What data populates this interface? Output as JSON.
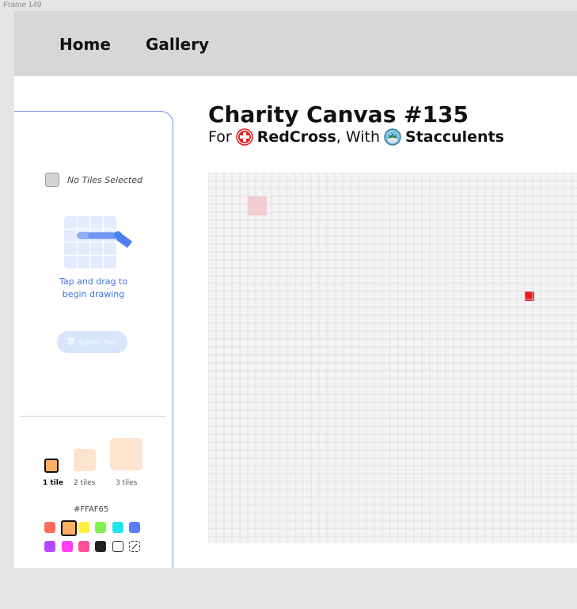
{
  "frame_label": "Frame 149",
  "nav": {
    "home": "Home",
    "gallery": "Gallery"
  },
  "sidebar": {
    "selection_text": "No Tiles Selected",
    "hint_line1": "Tap and drag to",
    "hint_line2": "begin drawing",
    "submit_label": "Submit Tiles",
    "sizes": [
      {
        "label": "1 tile",
        "active": true
      },
      {
        "label": "2 tiles",
        "active": false
      },
      {
        "label": "3 tiles",
        "active": false
      }
    ],
    "selected_hex": "#FFAF65",
    "palette": [
      {
        "name": "coral",
        "color": "#ff6b5b"
      },
      {
        "name": "orange",
        "color": "#ffaf65",
        "selected": true
      },
      {
        "name": "yellow",
        "color": "#ffef40"
      },
      {
        "name": "green",
        "color": "#7ff24d"
      },
      {
        "name": "cyan",
        "color": "#1ee6ea"
      },
      {
        "name": "blue",
        "color": "#5c7dff"
      },
      {
        "name": "purple",
        "color": "#b24bff"
      },
      {
        "name": "magenta",
        "color": "#ff3df2"
      },
      {
        "name": "pink",
        "color": "#ff4f9a"
      },
      {
        "name": "black",
        "color": "#222222"
      },
      {
        "name": "white",
        "color": "#ffffff"
      },
      {
        "name": "eraser",
        "color": "#ffffff"
      }
    ]
  },
  "main": {
    "title": "Charity Canvas #135",
    "for_word": "For",
    "charity": "RedCross",
    "with_word": ", With",
    "artist": "Stacculents"
  },
  "canvas": {
    "grid_color": "#dddddd",
    "background": "#f3f3f3",
    "tiles": [
      {
        "col": 5,
        "row": 3,
        "size": 2,
        "color": "#f6c9cc"
      },
      {
        "col": 40,
        "row": 15,
        "size": 1,
        "color": "#e81b22"
      }
    ],
    "columns": 47,
    "rows": 47
  }
}
